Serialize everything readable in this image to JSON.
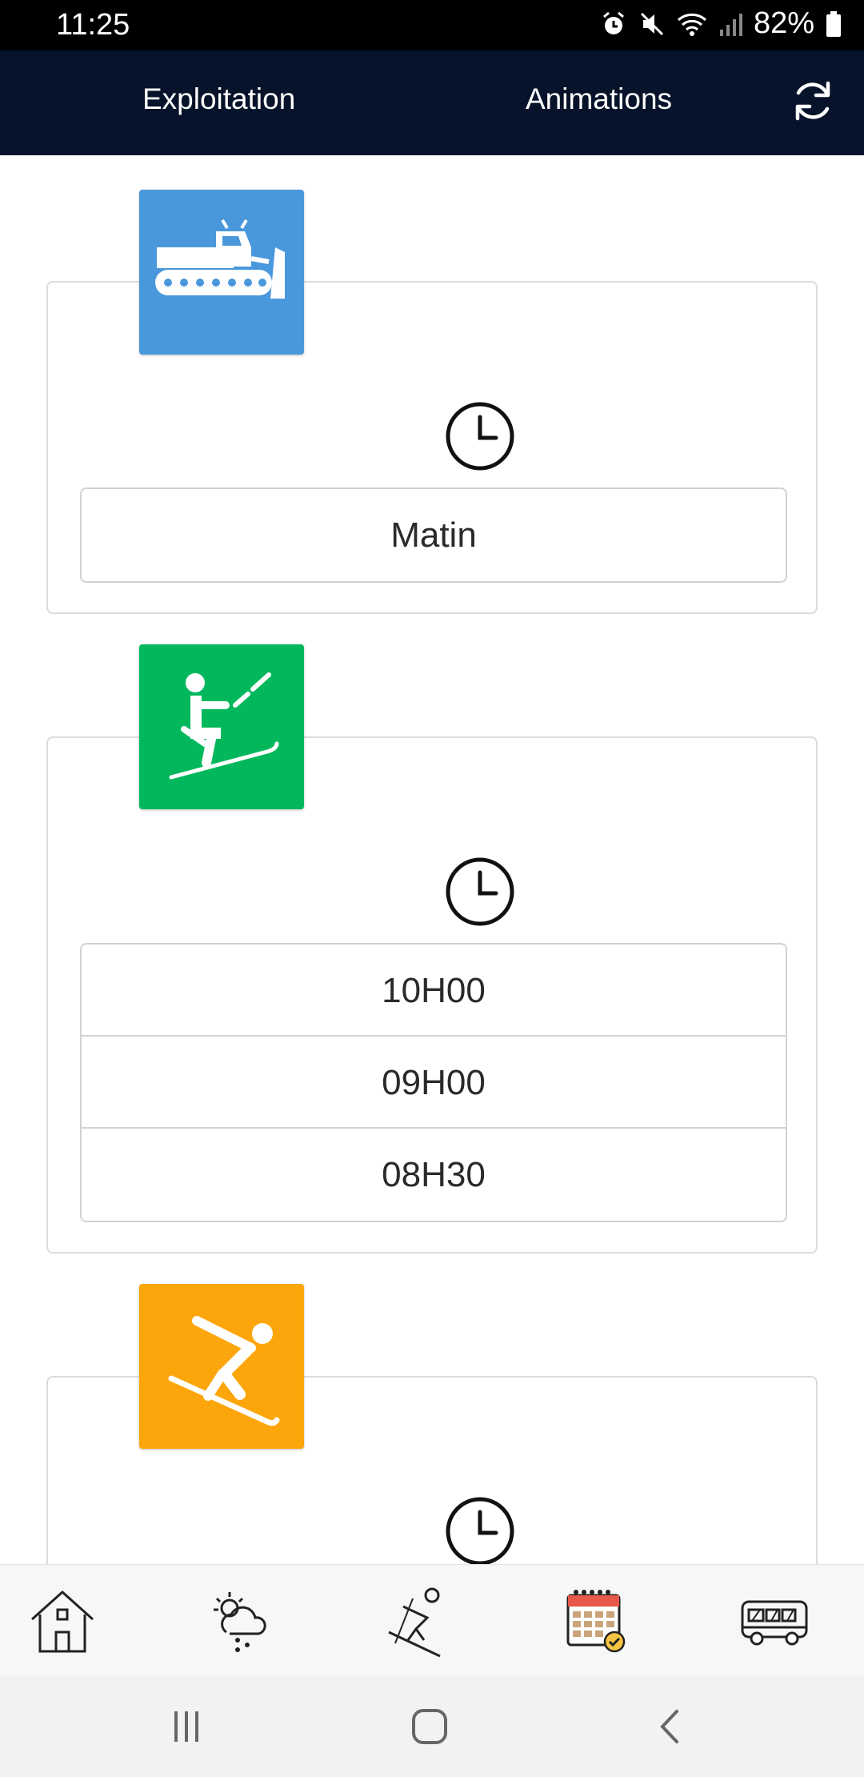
{
  "status_bar": {
    "time": "11:25",
    "battery": "82%",
    "icons": [
      "alarm-icon",
      "mute-icon",
      "wifi-icon",
      "signal-icon",
      "battery-icon"
    ]
  },
  "app_bar": {
    "tabs": [
      {
        "label": "Exploitation"
      },
      {
        "label": "Animations"
      }
    ],
    "refresh_icon": "refresh-icon"
  },
  "cards": [
    {
      "category": "grooming",
      "icon": "snow-groomer-icon",
      "color": "#4a98dc",
      "slots": [
        "Matin"
      ]
    },
    {
      "category": "lifts",
      "icon": "ski-lift-icon",
      "color": "#03b85c",
      "slots": [
        "10H00",
        "09H00",
        "08H30"
      ]
    },
    {
      "category": "skiing",
      "icon": "skier-icon",
      "color": "#fca60b",
      "slots": []
    }
  ],
  "bottom_nav": [
    "home-icon",
    "weather-icon",
    "skier-icon",
    "calendar-icon",
    "bus-icon"
  ],
  "system_nav": [
    "recents-icon",
    "home-button-icon",
    "back-icon"
  ]
}
